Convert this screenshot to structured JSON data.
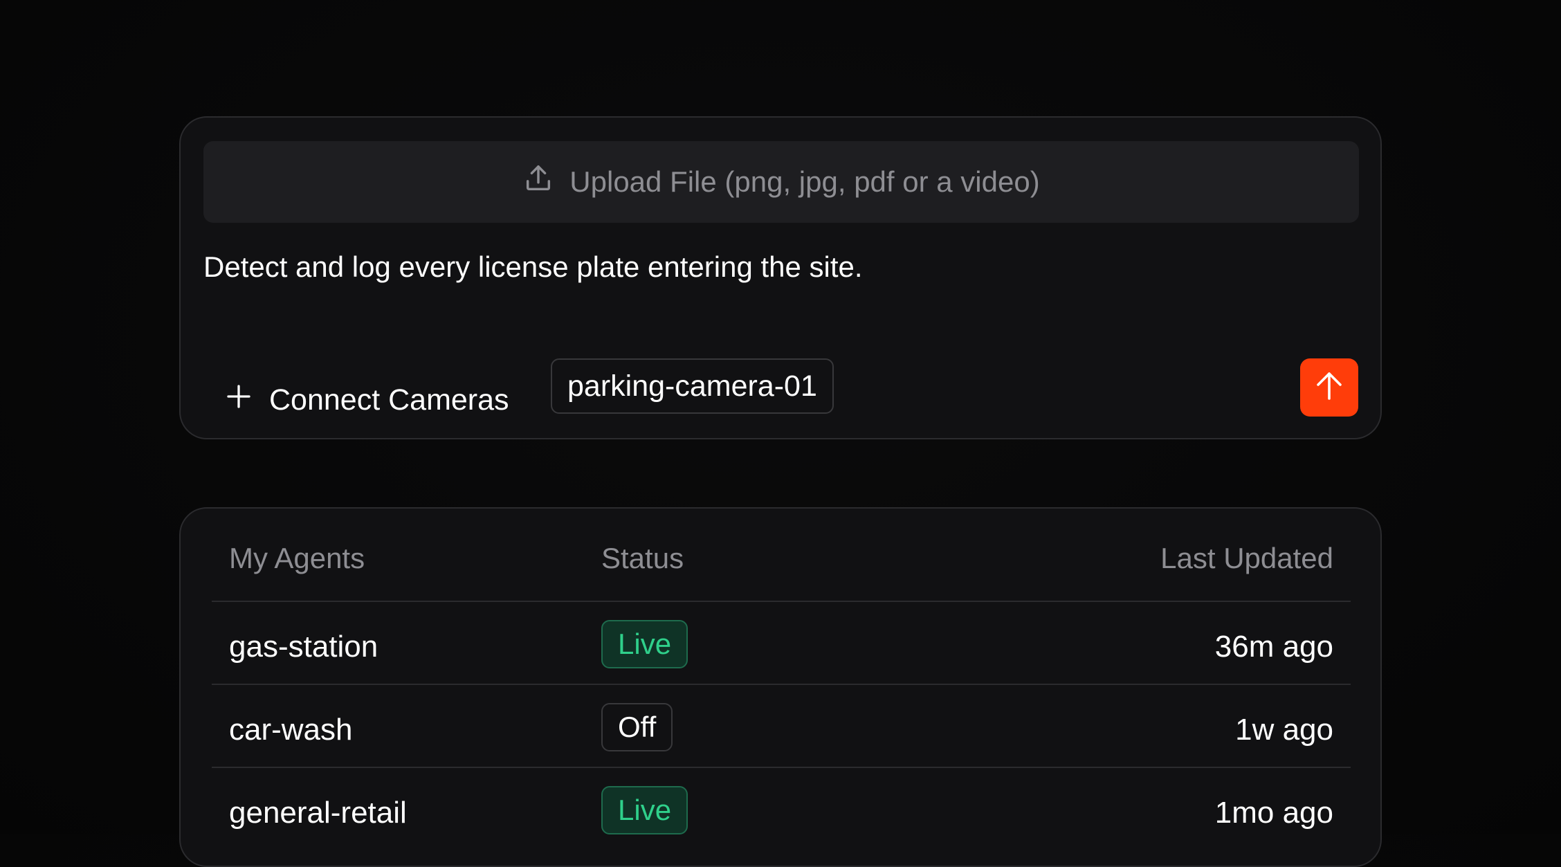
{
  "composer": {
    "upload_label": "Upload File (png, jpg, pdf or a video)",
    "upload_icon": "upload-icon",
    "prompt_text": "Detect and log every license plate entering the site.",
    "connect_label": "Connect Cameras",
    "connect_icon": "plus-icon",
    "camera_chip": "parking-camera-01",
    "send_icon": "arrow-up-icon",
    "send_color": "#ff3d0a"
  },
  "agents": {
    "headers": {
      "name": "My Agents",
      "status": "Status",
      "updated": "Last Updated"
    },
    "rows": [
      {
        "name": "gas-station",
        "status": "Live",
        "updated": "36m ago"
      },
      {
        "name": "car-wash",
        "status": "Off",
        "updated": "1w ago"
      },
      {
        "name": "general-retail",
        "status": "Live",
        "updated": "1mo ago"
      }
    ],
    "status_colors": {
      "live": "#2fd08b",
      "off": "#ffffff"
    }
  }
}
